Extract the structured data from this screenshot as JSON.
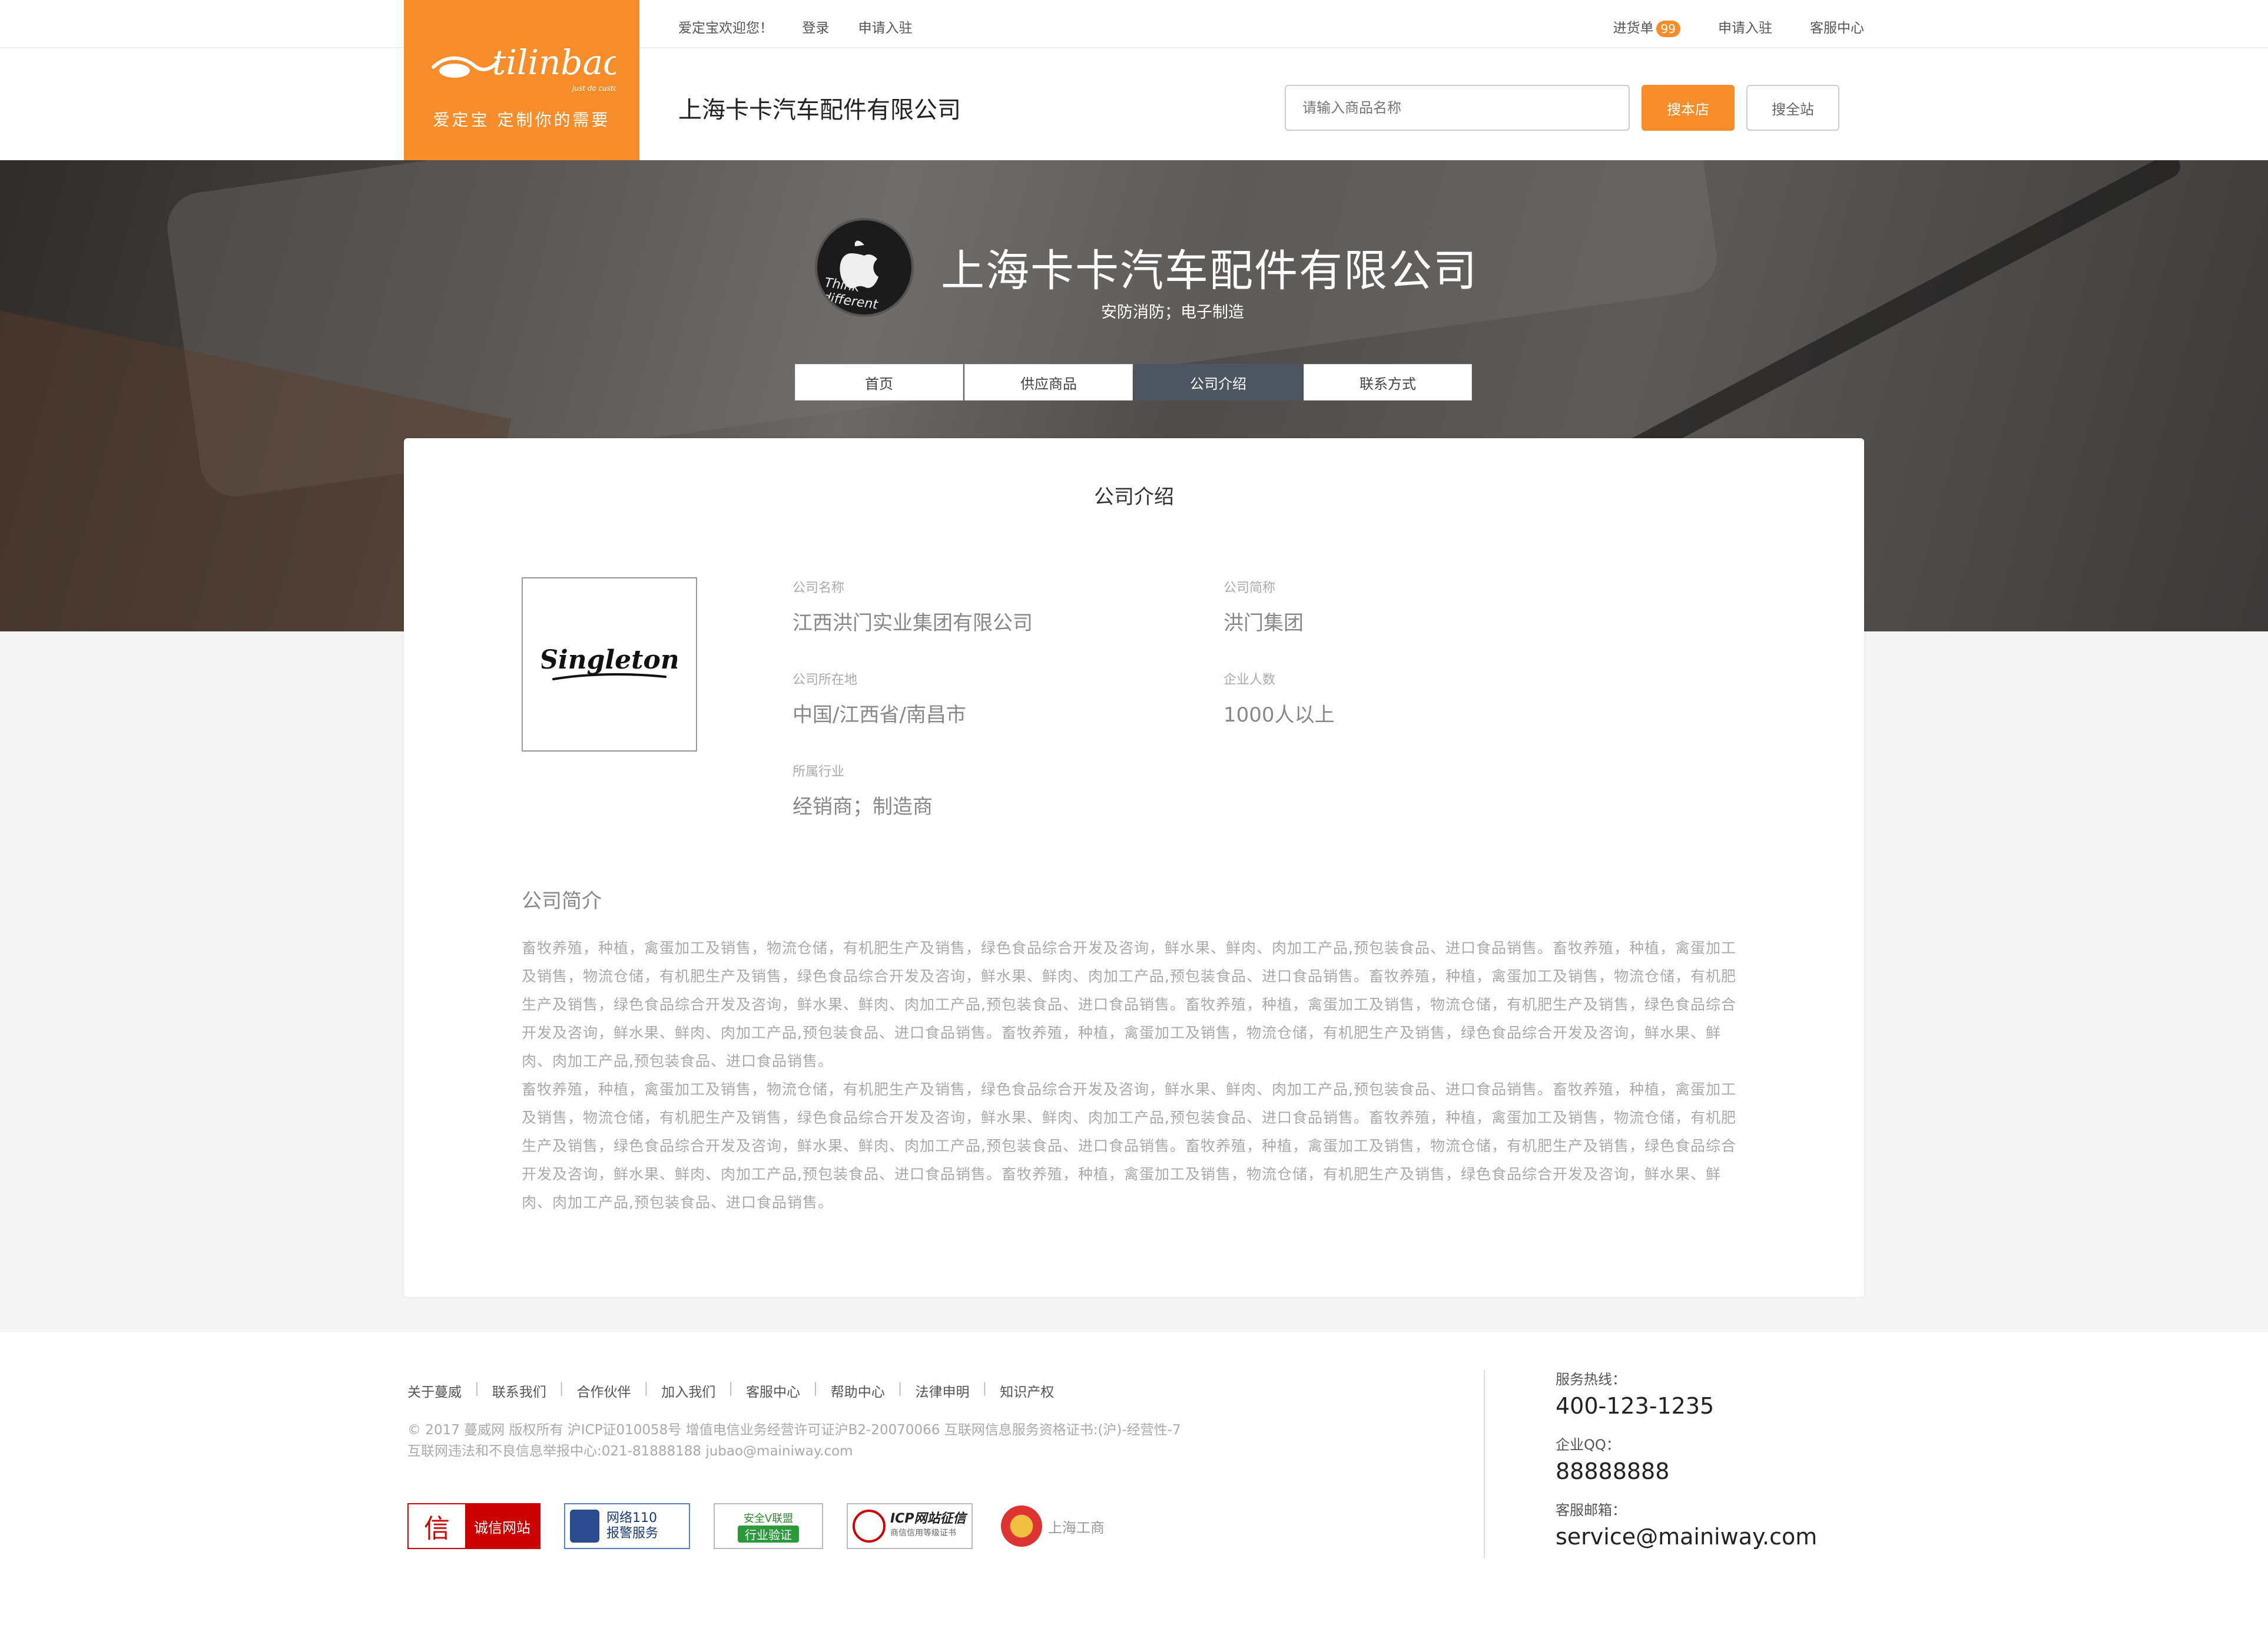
{
  "header": {
    "logo_script": "tilinbao",
    "logo_tagline": "just do custom",
    "logo_slogan": "爱定宝 定制你的需要",
    "welcome": "爱定宝欢迎您！",
    "login": "登录",
    "apply": "申请入驻",
    "cart_label": "进货单",
    "cart_count": "99",
    "apply_right": "申请入驻",
    "service": "客服中心",
    "shop_name": "上海卡卡汽车配件有限公司",
    "search_placeholder": "请输入商品名称",
    "search_store_btn": "搜本店",
    "search_all_btn": "搜全站"
  },
  "banner": {
    "avatar_text": "Think different",
    "title": "上海卡卡汽车配件有限公司",
    "subtitle": "安防消防；电子制造",
    "tabs": [
      {
        "label": "首页",
        "active": false
      },
      {
        "label": "供应商品",
        "active": false
      },
      {
        "label": "公司介绍",
        "active": true
      },
      {
        "label": "联系方式",
        "active": false
      }
    ]
  },
  "card": {
    "title": "公司介绍",
    "logo_text": "Singleton",
    "fields": {
      "name_label": "公司名称",
      "name_value": "江西洪门实业集团有限公司",
      "short_label": "公司简称",
      "short_value": "洪门集团",
      "location_label": "公司所在地",
      "location_value": "中国/江西省/南昌市",
      "size_label": "企业人数",
      "size_value": "1000人以上",
      "industry_label": "所属行业",
      "industry_value": "经销商；制造商"
    },
    "intro_title": "公司简介",
    "intro_paragraphs": [
      "畜牧养殖，种植，禽蛋加工及销售，物流仓储，有机肥生产及销售，绿色食品综合开发及咨询，鲜水果、鲜肉、肉加工产品,预包装食品、进口食品销售。畜牧养殖，种植，禽蛋加工及销售，物流仓储，有机肥生产及销售，绿色食品综合开发及咨询，鲜水果、鲜肉、肉加工产品,预包装食品、进口食品销售。畜牧养殖，种植，禽蛋加工及销售，物流仓储，有机肥生产及销售，绿色食品综合开发及咨询，鲜水果、鲜肉、肉加工产品,预包装食品、进口食品销售。畜牧养殖，种植，禽蛋加工及销售，物流仓储，有机肥生产及销售，绿色食品综合开发及咨询，鲜水果、鲜肉、肉加工产品,预包装食品、进口食品销售。畜牧养殖，种植，禽蛋加工及销售，物流仓储，有机肥生产及销售，绿色食品综合开发及咨询，鲜水果、鲜肉、肉加工产品,预包装食品、进口食品销售。",
      "畜牧养殖，种植，禽蛋加工及销售，物流仓储，有机肥生产及销售，绿色食品综合开发及咨询，鲜水果、鲜肉、肉加工产品,预包装食品、进口食品销售。畜牧养殖，种植，禽蛋加工及销售，物流仓储，有机肥生产及销售，绿色食品综合开发及咨询，鲜水果、鲜肉、肉加工产品,预包装食品、进口食品销售。畜牧养殖，种植，禽蛋加工及销售，物流仓储，有机肥生产及销售，绿色食品综合开发及咨询，鲜水果、鲜肉、肉加工产品,预包装食品、进口食品销售。畜牧养殖，种植，禽蛋加工及销售，物流仓储，有机肥生产及销售，绿色食品综合开发及咨询，鲜水果、鲜肉、肉加工产品,预包装食品、进口食品销售。畜牧养殖，种植，禽蛋加工及销售，物流仓储，有机肥生产及销售，绿色食品综合开发及咨询，鲜水果、鲜肉、肉加工产品,预包装食品、进口食品销售。"
    ]
  },
  "footer": {
    "links": [
      "关于蔓威",
      "联系我们",
      "合作伙伴",
      "加入我们",
      "客服中心",
      "帮助中心",
      "法律申明",
      "知识产权"
    ],
    "copyright_line1": "© 2017 蔓威网 版权所有  沪ICP证010058号   增值电信业务经营许可证沪B2-20070066      互联网信息服务资格证书:(沪)-经营性-7",
    "copyright_line2": "互联网违法和不良信息举报中心:021-81888188 jubao@mainiway.com",
    "badges": {
      "b1_icon": "信",
      "b1_text": "诚信网站",
      "b2_text1": "网络110",
      "b2_text2": "报警服务",
      "b3_text1": "安全V联盟",
      "b3_text2": "行业验证",
      "b4_text1": "ICP网站征信",
      "b4_text2": "商信信用等级证书",
      "b5_text": "上海工商"
    },
    "hotline_label": "服务热线：",
    "hotline_value": "400-123-1235",
    "qq_label": "企业QQ：",
    "qq_value": "88888888",
    "email_label": "客服邮箱：",
    "email_value": "service@mainiway.com"
  },
  "colors": {
    "accent": "#f78c2a",
    "tab_active": "#4d5462"
  }
}
